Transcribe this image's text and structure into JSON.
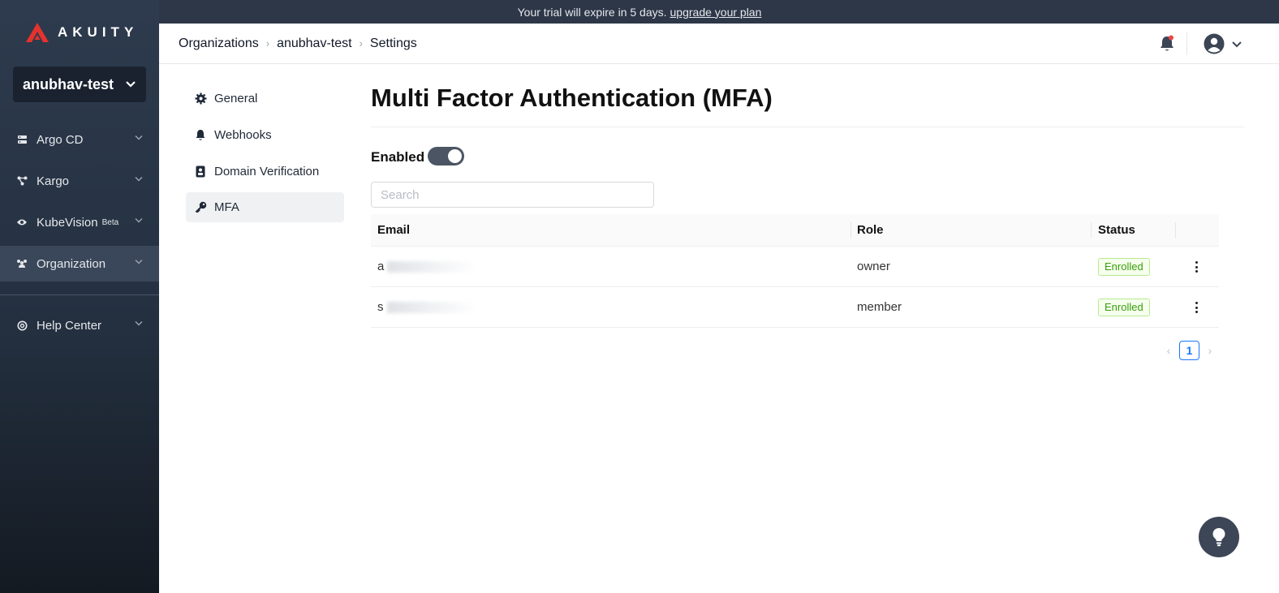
{
  "banner": {
    "text": "Your trial will expire in 5 days.",
    "link": "upgrade your plan"
  },
  "sidebar": {
    "logo": "AKUITY",
    "org": "anubhav-test",
    "items": [
      {
        "label": "Argo CD",
        "icon": "server-icon"
      },
      {
        "label": "Kargo",
        "icon": "kargo-icon"
      },
      {
        "label": "KubeVision",
        "badge": "Beta",
        "icon": "eye-icon"
      },
      {
        "label": "Organization",
        "icon": "team-icon",
        "active": true
      },
      {
        "label": "Help Center",
        "icon": "lifebuoy-icon"
      }
    ]
  },
  "header": {
    "breadcrumb": [
      "Organizations",
      "anubhav-test",
      "Settings"
    ]
  },
  "settings_menu": [
    {
      "label": "General",
      "icon": "gear-icon"
    },
    {
      "label": "Webhooks",
      "icon": "bell-icon"
    },
    {
      "label": "Domain Verification",
      "icon": "badge-icon"
    },
    {
      "label": "MFA",
      "icon": "key-icon",
      "active": true
    }
  ],
  "main": {
    "title": "Multi Factor Authentication (MFA)",
    "enabled_label": "Enabled",
    "enabled": true,
    "search_placeholder": "Search",
    "columns": [
      "Email",
      "Role",
      "Status"
    ],
    "rows": [
      {
        "email": "a",
        "role": "owner",
        "status": "Enrolled"
      },
      {
        "email": "s",
        "role": "member",
        "status": "Enrolled"
      }
    ],
    "page": "1"
  },
  "colors": {
    "accent": "#1677ff",
    "enrolled": "#389e0d",
    "brand_red": "#e5322d"
  }
}
